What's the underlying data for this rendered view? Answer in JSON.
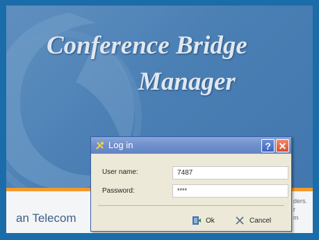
{
  "app": {
    "title_line1": "Conference Bridge",
    "title_line2": "Manager",
    "brand_text": "an Telecom",
    "side_text_lines": [
      "ders.",
      "r",
      "m"
    ]
  },
  "dialog": {
    "title": "Log in",
    "help_label": "?",
    "close_label": "✕",
    "username_label": "User name:",
    "username_value": "7487",
    "password_label": "Password:",
    "password_value": "****",
    "ok_label": "Ok",
    "cancel_label": "Cancel"
  },
  "colors": {
    "frame": "#1a6da8",
    "background": "#4a7fb4",
    "accent_stripe": "#f29a2e",
    "titlebar": "#6f8fcc"
  },
  "icons": {
    "app": "key-icon",
    "ok": "door-icon",
    "cancel": "x-icon"
  }
}
